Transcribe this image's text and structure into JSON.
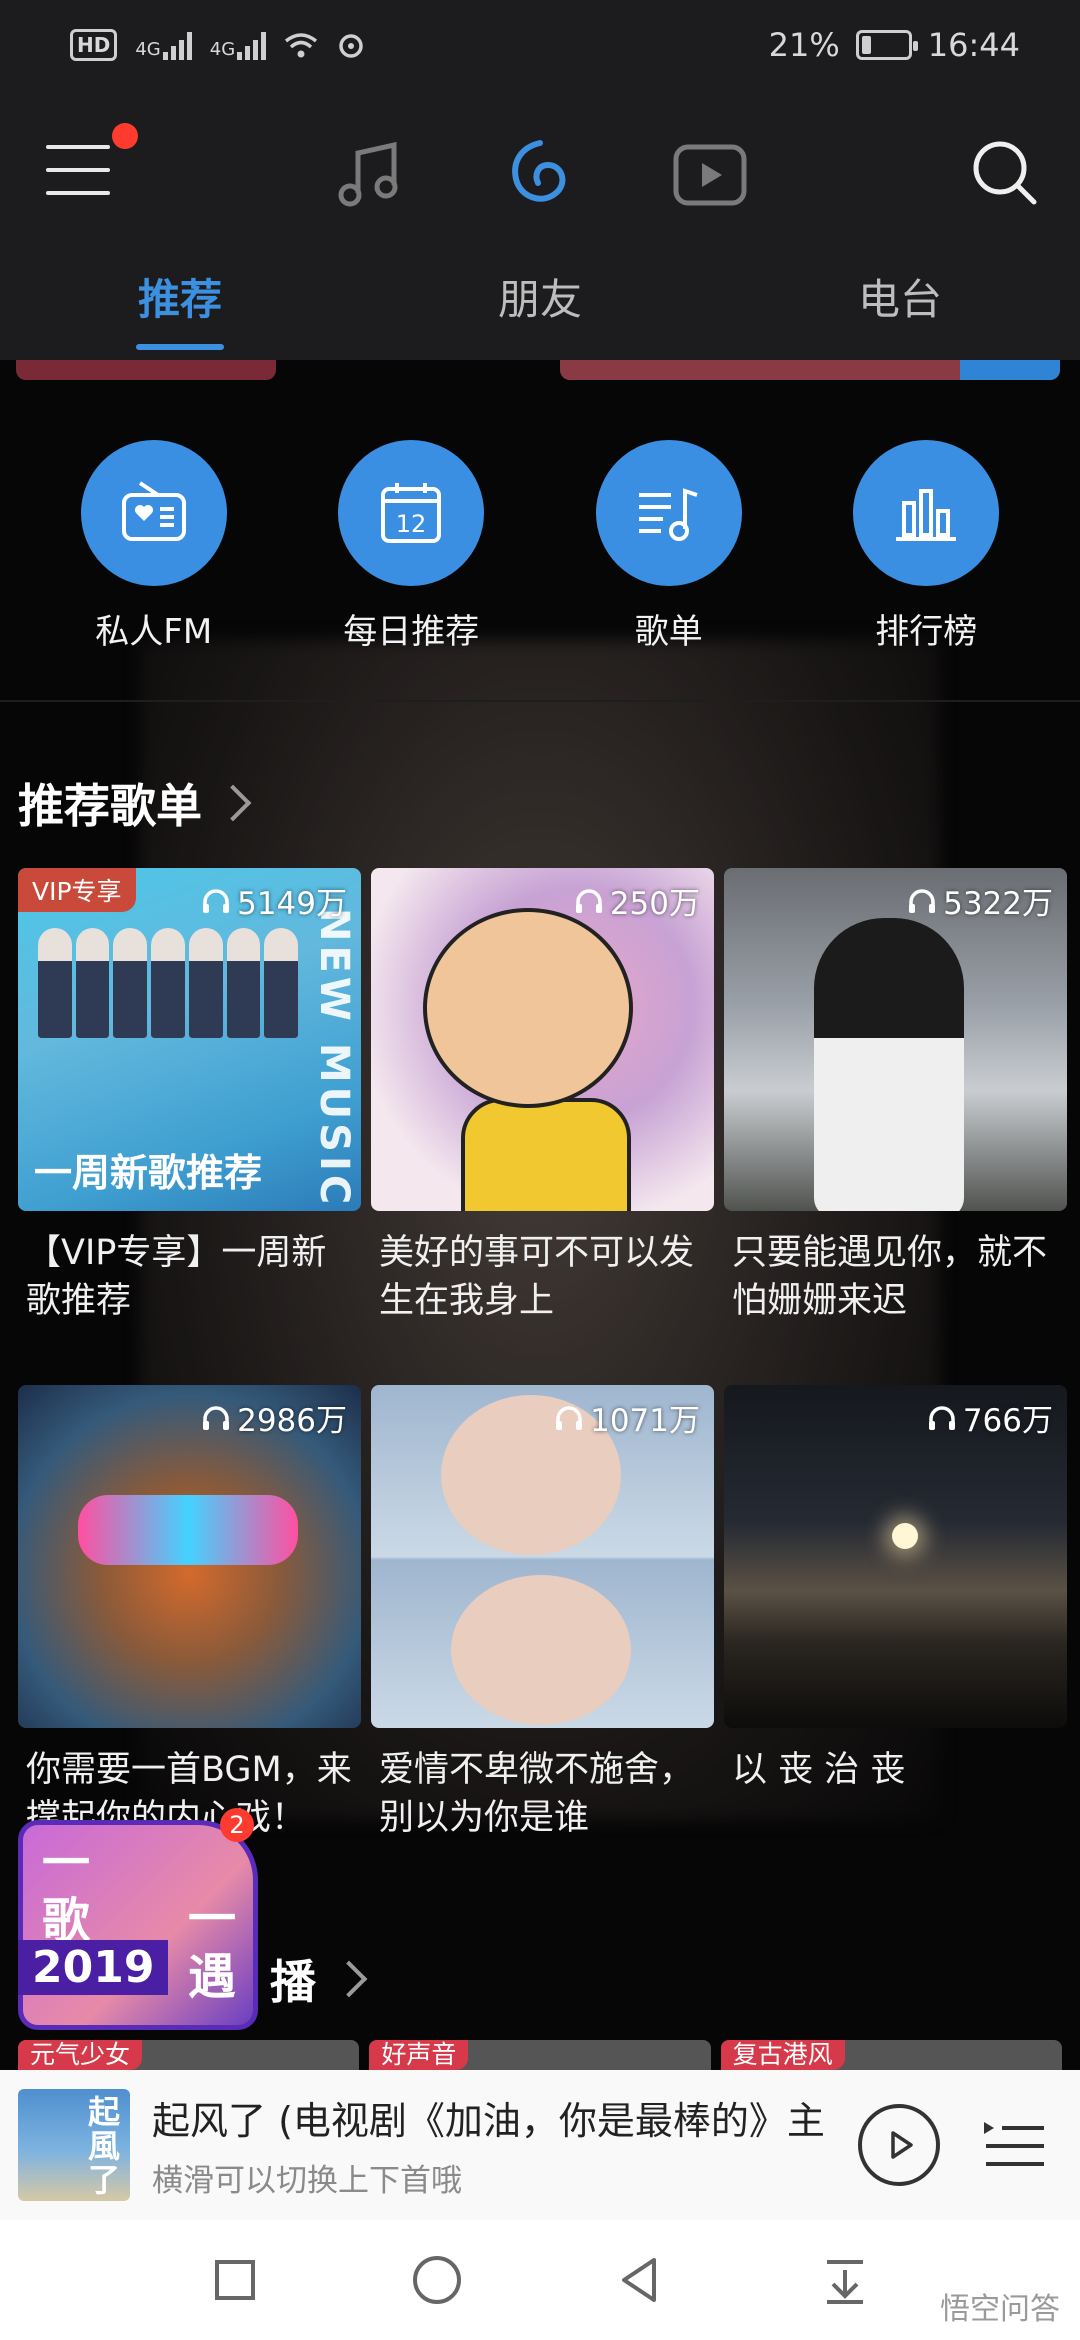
{
  "status_bar": {
    "hd": "HD",
    "net1": "4G",
    "net2": "4G",
    "battery_text": "21%",
    "battery_level": 0.21,
    "time": "16:44"
  },
  "header": {
    "tabs": [
      {
        "label": "推荐",
        "active": true
      },
      {
        "label": "朋友",
        "active": false
      },
      {
        "label": "电台",
        "active": false
      }
    ],
    "accent_color": "#3d8fe0"
  },
  "quick_entries": [
    {
      "label": "私人FM",
      "icon": "radio-icon"
    },
    {
      "label": "每日推荐",
      "icon": "calendar-icon",
      "icon_text": "12"
    },
    {
      "label": "歌单",
      "icon": "playlist-icon"
    },
    {
      "label": "排行榜",
      "icon": "chart-icon"
    }
  ],
  "recommended": {
    "title": "推荐歌单",
    "playlists": [
      {
        "title": "【VIP专享】一周新歌推荐",
        "count": "5149万",
        "tag": "VIP专享",
        "cover_caption": "一周新歌推荐",
        "cover_vertical": "NEW MUSIC"
      },
      {
        "title": "美好的事可不可以发生在我身上",
        "count": "250万"
      },
      {
        "title": "只要能遇见你，就不怕姗姗来迟",
        "count": "5322万"
      },
      {
        "title": "你需要一首BGM，来撑起你的内心戏！",
        "count": "2986万"
      },
      {
        "title": "爱情不卑微不施舍，别以为你是谁",
        "count": "1071万"
      },
      {
        "title": "以 丧 治 丧",
        "count": "766万"
      }
    ]
  },
  "promo": {
    "line1": "一歌",
    "line2": "一遇",
    "year": "2019",
    "badge": "2"
  },
  "section2": {
    "title": "播"
  },
  "next_row_tags": [
    "元气少女",
    "好声音",
    "复古港风"
  ],
  "player": {
    "cover_text": "起風了",
    "title": "起风了 (电视剧《加油，你是最棒的》主",
    "subtitle": "横滑可以切换上下首哦"
  },
  "watermark": "悟空问答"
}
